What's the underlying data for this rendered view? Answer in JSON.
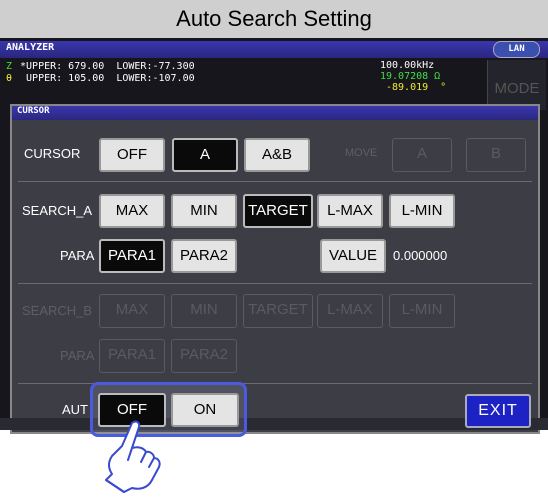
{
  "caption": "Auto Search Setting",
  "analyzer": {
    "title": "ANALYZER",
    "lan": "LAN",
    "mode": "MODE"
  },
  "readout": {
    "z_prefix": "Z",
    "z_text": " *UPPER: 679.00  LOWER:-77.300",
    "theta_prefix": "θ",
    "theta_text": "  UPPER: 105.00  LOWER:-107.00",
    "freq": "100.00kHz",
    "z_value": "19.07208 Ω",
    "theta_value": "-89.019  °"
  },
  "dialog": {
    "title": "CURSOR",
    "cursor": {
      "label": "CURSOR",
      "off": "OFF",
      "a": "A",
      "ab": "A&B",
      "move": "MOVE",
      "move_a": "A",
      "move_b": "B"
    },
    "search_a": {
      "label": "SEARCH_A",
      "max": "MAX",
      "min": "MIN",
      "target": "TARGET",
      "lmax": "L-MAX",
      "lmin": "L-MIN"
    },
    "para_a": {
      "label": "PARA",
      "p1": "PARA1",
      "p2": "PARA2",
      "value_btn": "VALUE",
      "value": "0.000000"
    },
    "search_b": {
      "label": "SEARCH_B",
      "max": "MAX",
      "min": "MIN",
      "target": "TARGET",
      "lmax": "L-MAX",
      "lmin": "L-MIN"
    },
    "para_b": {
      "label": "PARA",
      "p1": "PARA1",
      "p2": "PARA2"
    },
    "auto": {
      "label": "AUT",
      "off": "OFF",
      "on": "ON"
    },
    "exit": "EXIT"
  },
  "colors": {
    "accent": "#4b5be0",
    "exit": "#1c22c4",
    "z_green": "#44dd44",
    "theta_yellow": "#eeee33"
  }
}
